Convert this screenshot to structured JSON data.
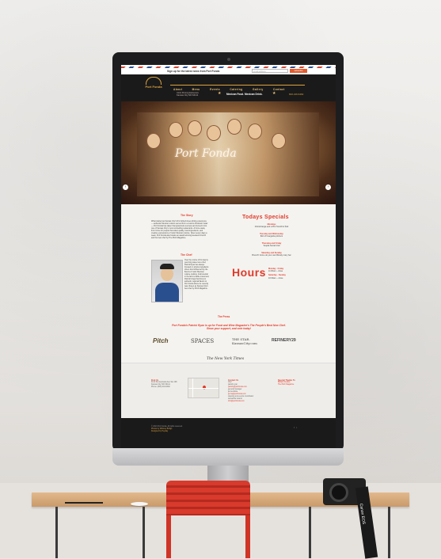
{
  "signup": {
    "text": "Sign up for the latest news from Port Fonda",
    "email_placeholder": "email address",
    "button": "subscribe"
  },
  "header": {
    "logo": "Port Fonda",
    "nav": [
      "About",
      "Menu",
      "Events",
      "Catering",
      "Gallery",
      "Contact"
    ],
    "address_line1": "4141 Pennsylvania Ave",
    "address_line2": "Kansas City MO 64111",
    "tagline": "Mexican Food. Mexican Drink.",
    "phone": "816.216.6462"
  },
  "hero": {
    "title": "Port Fonda"
  },
  "story": {
    "heading": "The Story",
    "body": "What started as Kansas City's first Airbed street-dining experience — authentic Mexican cuisine served from a custom Airstream trailer — Port Fonda has taken that grassroots success and turned it into one of Kansas City's most compelling restaurants. A home away from home for people that value quality, local ingredients, and creative expressions of rustic Mexican cuisine. Open seven days a week, Port Fonda also boasts an award-winning weekend brunch and the best chef by The Pitch Magazine.",
    "chef_heading": "The Chef",
    "chef_body": "Over the course of his twenty year long career as a chef, Patrick Ryan has always focused on simple ingredients driven food influenced by the flavors of rustic Mexican cuisine cooking. Instrumental in the farm-to-table movement, Patrick brings that focus to authentic regional flavors to Port Fonda where he recently was chosen as Kansas City's best chef by Pitch Magazine."
  },
  "specials": {
    "heading": "Todays Specials",
    "items": [
      {
        "day": "Mondays",
        "text": "Chimichanga and a Pint Tonsill for $12"
      },
      {
        "day": "Tuesday and Wednesday",
        "text": "$10 off margarita pitchers"
      },
      {
        "day": "Thursday and Friday",
        "text": "Tequila Social Club"
      },
      {
        "day": "Saturday and Sunday",
        "text": "Brunch! Come do your own Bloody mary bar"
      }
    ]
  },
  "hours": {
    "label": "Hours",
    "weekday_title": "Monday - Friday",
    "weekday_hours": "11:00am – close",
    "weekend_title": "Saturday - Sunday",
    "weekend_hours": "10:00am – close"
  },
  "press": {
    "heading": "The Press",
    "line1": "Port Fonda's Patrick Ryan is up for Food and Wine Magazine's The People's Best New Chef.",
    "line2": "Show your support, and vote today!",
    "logos": [
      "Pitch",
      "SPACES",
      "THE STAR. KansasCity.com",
      "REFINERY29",
      "The New York Times"
    ]
  },
  "footer": {
    "find_heading": "Find Us",
    "find_lines": [
      "4141 Pennsylvania Ave Ste 108",
      "Kansas City, MO 64111",
      "",
      "Phone: (816) 216-6462"
    ],
    "contact_heading": "Contact Us",
    "contact_lines": [
      "chef",
      "patrick ryan",
      "patrick@portfonda.com",
      "",
      "general manager",
      "jenna dickie",
      "jenna@portfonda.com",
      "",
      "catering and events coordinator",
      "samantha ireland",
      "info@portfonda.com"
    ],
    "press_heading": "Special Thanks To",
    "press_lines": [
      "Bollard Studios",
      "The Pitch Magazine"
    ]
  },
  "bottom": {
    "copyright": "© 2013 Port Fonda. All rights reserved.",
    "credit1": "Photos by Whitney Bridge",
    "credit2": "Designed by Heyday"
  },
  "mockup": {
    "camera_brand": "Canon EOS"
  }
}
